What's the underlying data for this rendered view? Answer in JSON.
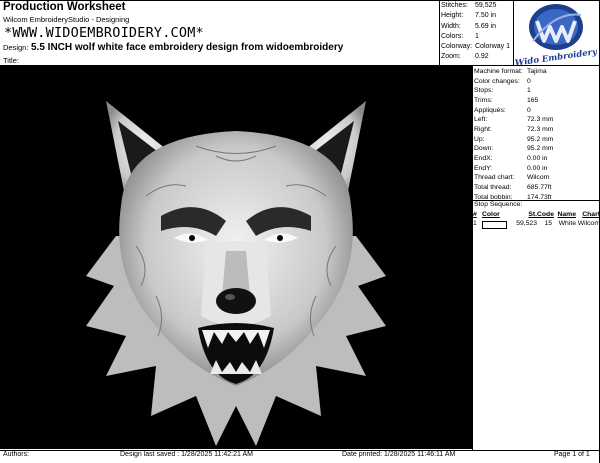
{
  "header": {
    "title": "Production Worksheet",
    "subtitle": "Wilcom EmbroideryStudio - Designing",
    "watermark_url": "*WWW.WIDOEMBROIDERY.COM*",
    "design_label": "Design:",
    "design_name": "5.5 INCH wolf white face embroidery design from widoembroidery",
    "title_label": "Title:"
  },
  "stats": [
    {
      "label": "Stitches:",
      "value": "59,525"
    },
    {
      "label": "Height:",
      "value": "7.50 in"
    },
    {
      "label": "Width:",
      "value": "5.69 in"
    },
    {
      "label": "Colors:",
      "value": "1"
    },
    {
      "label": "Colorway:",
      "value": "Colorway 1"
    },
    {
      "label": "Zoom:",
      "value": "0.92"
    }
  ],
  "logo": {
    "text": "Wido Embroidery",
    "color": "#1d3f8f"
  },
  "details": [
    {
      "label": "Machine format:",
      "value": "Tajima"
    },
    {
      "label": "Color changes:",
      "value": "0"
    },
    {
      "label": "Stops:",
      "value": "1"
    },
    {
      "label": "Trims:",
      "value": "165"
    },
    {
      "label": "Appliqués:",
      "value": "0"
    },
    {
      "label": "Left:",
      "value": "72.3 mm"
    },
    {
      "label": "Right:",
      "value": "72.3 mm"
    },
    {
      "label": "Up:",
      "value": "95.2 mm"
    },
    {
      "label": "Down:",
      "value": "95.2 mm"
    },
    {
      "label": "EndX:",
      "value": "0.00 in"
    },
    {
      "label": "EndY:",
      "value": "0.00 in"
    },
    {
      "label": "Thread chart:",
      "value": "Wilcom"
    },
    {
      "label": "Total thread:",
      "value": "685.77ft"
    },
    {
      "label": "Total bobbin:",
      "value": "174.73ft"
    }
  ],
  "stop_sequence": {
    "label": "Stop Sequence:",
    "columns": [
      "#",
      "Color",
      "St.",
      "Code",
      "Name",
      "Chart"
    ],
    "rows": [
      {
        "num": "1",
        "color": "#ffffff",
        "st": "59,523",
        "code": "15",
        "name": "White",
        "chart": "Wilcom"
      }
    ]
  },
  "footer": {
    "authors_label": "Authors:",
    "last_saved": "Design last saved : 1/28/2025 11:42:21 AM",
    "printed": "Date printed: 1/28/2025 11:46:11 AM",
    "page": "Page 1 of 1"
  }
}
